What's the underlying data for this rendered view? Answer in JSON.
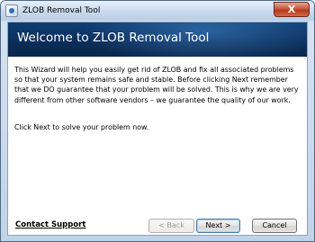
{
  "window": {
    "title": "ZLOB Removal Tool",
    "close_label": "X"
  },
  "banner": {
    "title": "Welcome to ZLOB Removal Tool"
  },
  "body": {
    "intro": "This Wizard will help you easily get rid of ZLOB and fix all associated problems so that your system remains safe and stable. Before clicking Next remember that we DO guarantee that your problem will be solved. This is why we are very different from other software vendors – we guarantee the quality of our work.",
    "instruction": "Click Next to solve your problem now."
  },
  "footer": {
    "support_link": "Contact Support",
    "back_label": "< Back",
    "next_label": "Next >",
    "cancel_label": "Cancel"
  },
  "colors": {
    "banner": "#0b2f5c",
    "window_frame": "#c0d3e8",
    "close_button": "#c85a40"
  },
  "icons": {
    "app": "app-icon",
    "close": "close-icon"
  }
}
